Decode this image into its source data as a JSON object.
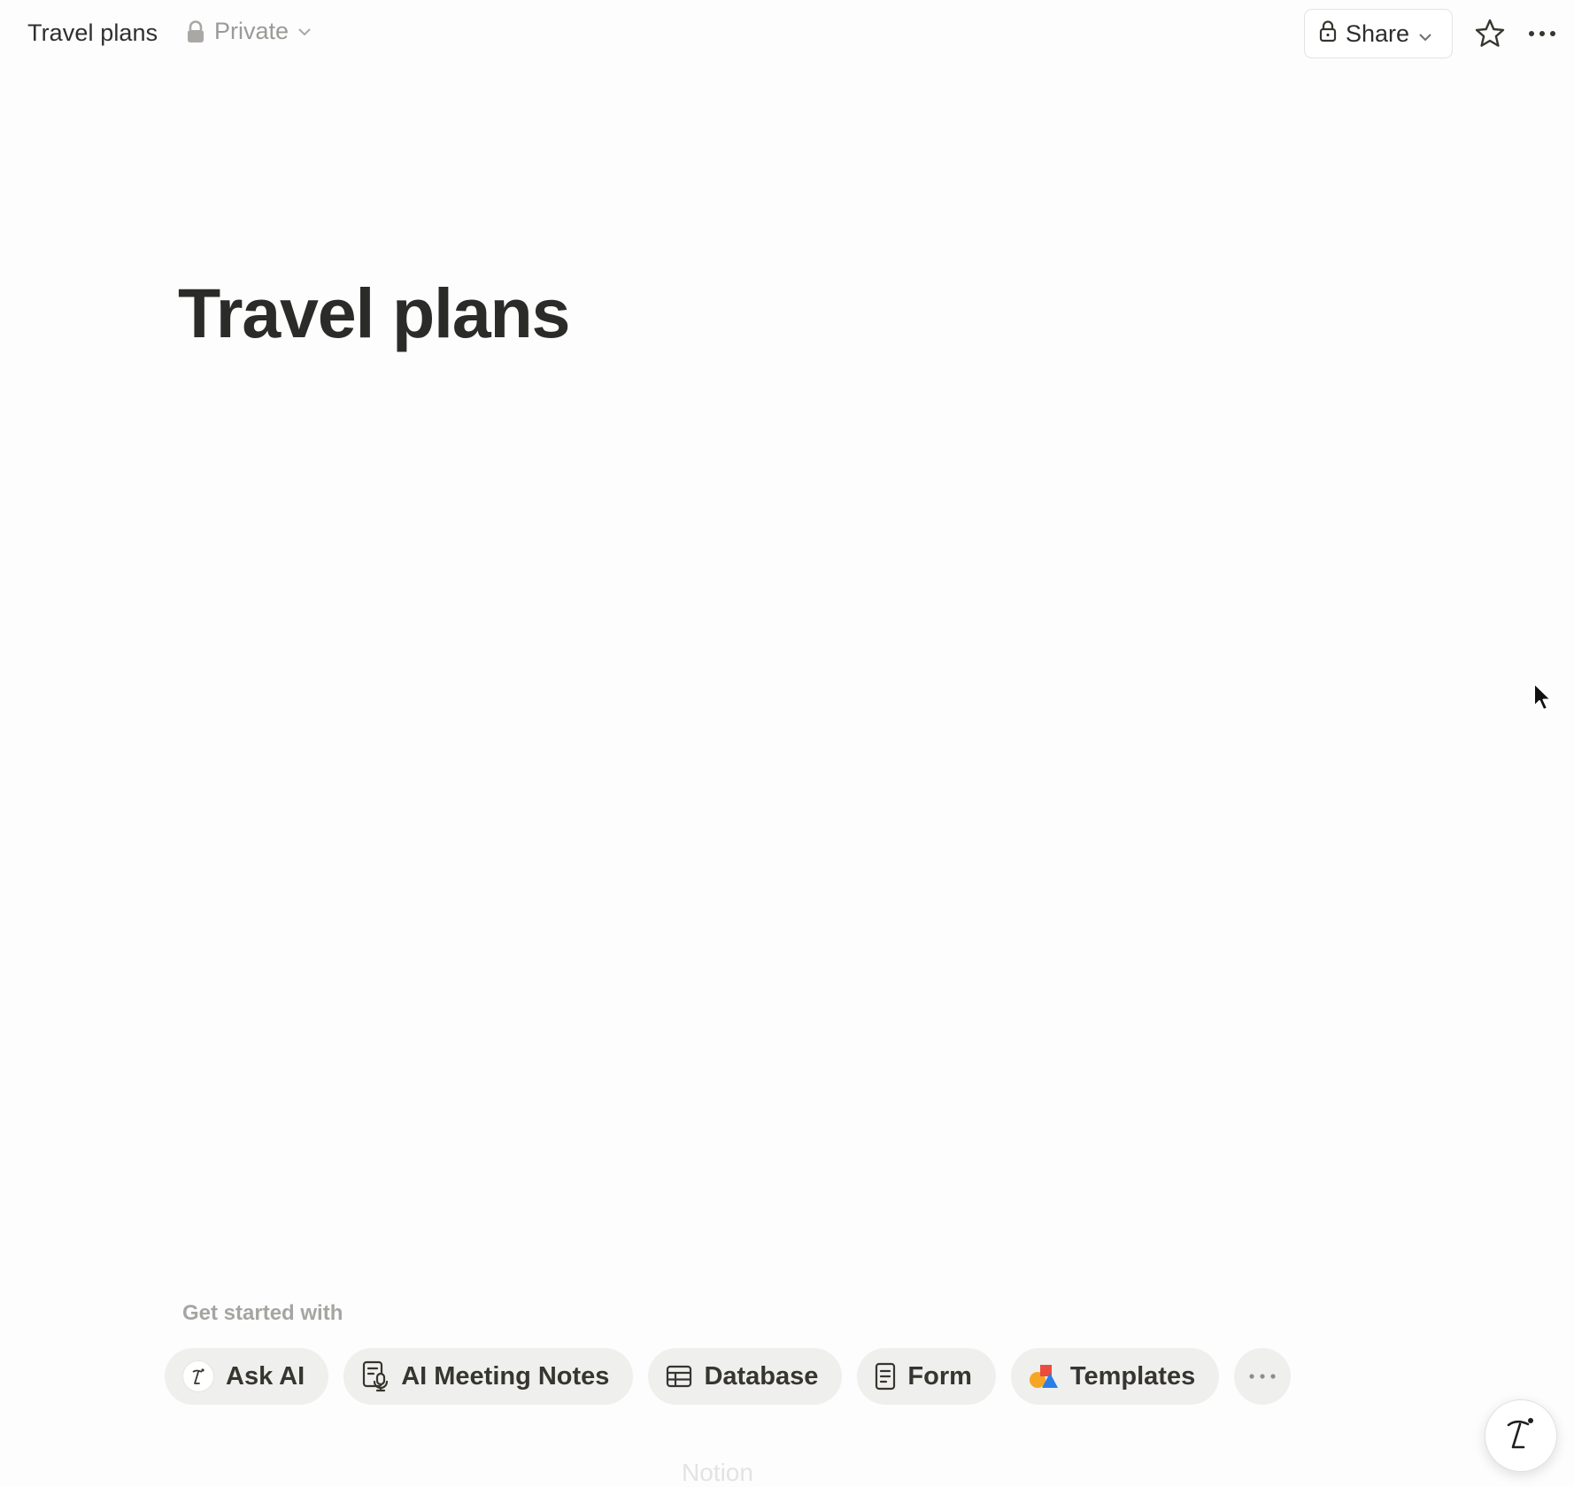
{
  "header": {
    "breadcrumb_title": "Travel plans",
    "privacy_label": "Private",
    "share_label": "Share",
    "icons": [
      "lock-icon",
      "chevron-down-icon",
      "star-icon",
      "more-horizontal-icon"
    ]
  },
  "page": {
    "title": "Travel plans"
  },
  "get_started": {
    "label": "Get started with",
    "chips": [
      {
        "label": "Ask AI",
        "icon": "notion-ai-icon"
      },
      {
        "label": "AI Meeting Notes",
        "icon": "meeting-notes-icon"
      },
      {
        "label": "Database",
        "icon": "table-icon"
      },
      {
        "label": "Form",
        "icon": "form-icon"
      },
      {
        "label": "Templates",
        "icon": "templates-icon"
      },
      {
        "label": "",
        "icon": "more-horizontal-icon"
      }
    ]
  },
  "footer": {
    "watermark": "Notion"
  },
  "colors": {
    "background": "#fdfdfd",
    "chip_background": "#efefed",
    "muted_text": "#9b9a97",
    "text": "#37352f"
  }
}
